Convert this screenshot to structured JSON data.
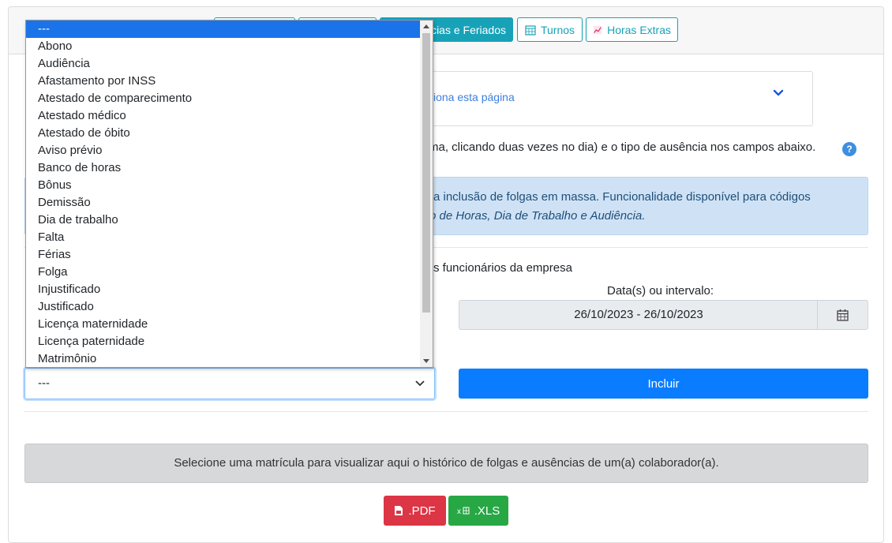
{
  "tabs": [
    {
      "label": "",
      "active": false
    },
    {
      "label": "",
      "active": false
    },
    {
      "label": "Ausências e Feriados",
      "visible_label": "cias e Feriados",
      "active": true
    },
    {
      "label": "Turnos",
      "icon": "calendar-grid-icon",
      "active": false
    },
    {
      "label": "Horas Extras",
      "icon": "chart-line-icon",
      "active": false
    }
  ],
  "accordion": {
    "link_text": "ciona esta página",
    "icon": "chevron-down-icon"
  },
  "instruction": {
    "text": "ma, clicando duas vezes no dia) e o tipo de ausência nos campos abaixo.",
    "help_icon": "question-icon"
  },
  "alert": {
    "line1": "ra inclusão de folgas em massa. Funcionalidade disponível para códigos",
    "line2": "o de Horas, Dia de Trabalho e Audiência."
  },
  "employees_text": "s funcionários da empresa",
  "date": {
    "label": "Data(s) ou intervalo:",
    "value": "26/10/2023 - 26/10/2023",
    "icon": "calendar-icon"
  },
  "include_button": "Incluir",
  "select": {
    "value": "---"
  },
  "dropdown": {
    "options": [
      "---",
      "Abono",
      "Audiência",
      "Afastamento por INSS",
      "Atestado de comparecimento",
      "Atestado médico",
      "Atestado de óbito",
      "Aviso prévio",
      "Banco de horas",
      "Bônus",
      "Demissão",
      "Dia de trabalho",
      "Falta",
      "Férias",
      "Folga",
      "Injustificado",
      "Justificado",
      "Licença maternidade",
      "Licença paternidade",
      "Matrimônio"
    ],
    "selected": 0
  },
  "history_text": "Selecione uma matrícula para visualizar aqui o histórico de folgas e ausências de um(a) colaborador(a).",
  "export": {
    "pdf_label": ".PDF",
    "xls_label": ".XLS"
  },
  "colors": {
    "accent": "#17a2b8",
    "primary": "#0a7cff",
    "danger": "#dc3545",
    "success": "#28a745",
    "selected": "#1a73e8"
  }
}
